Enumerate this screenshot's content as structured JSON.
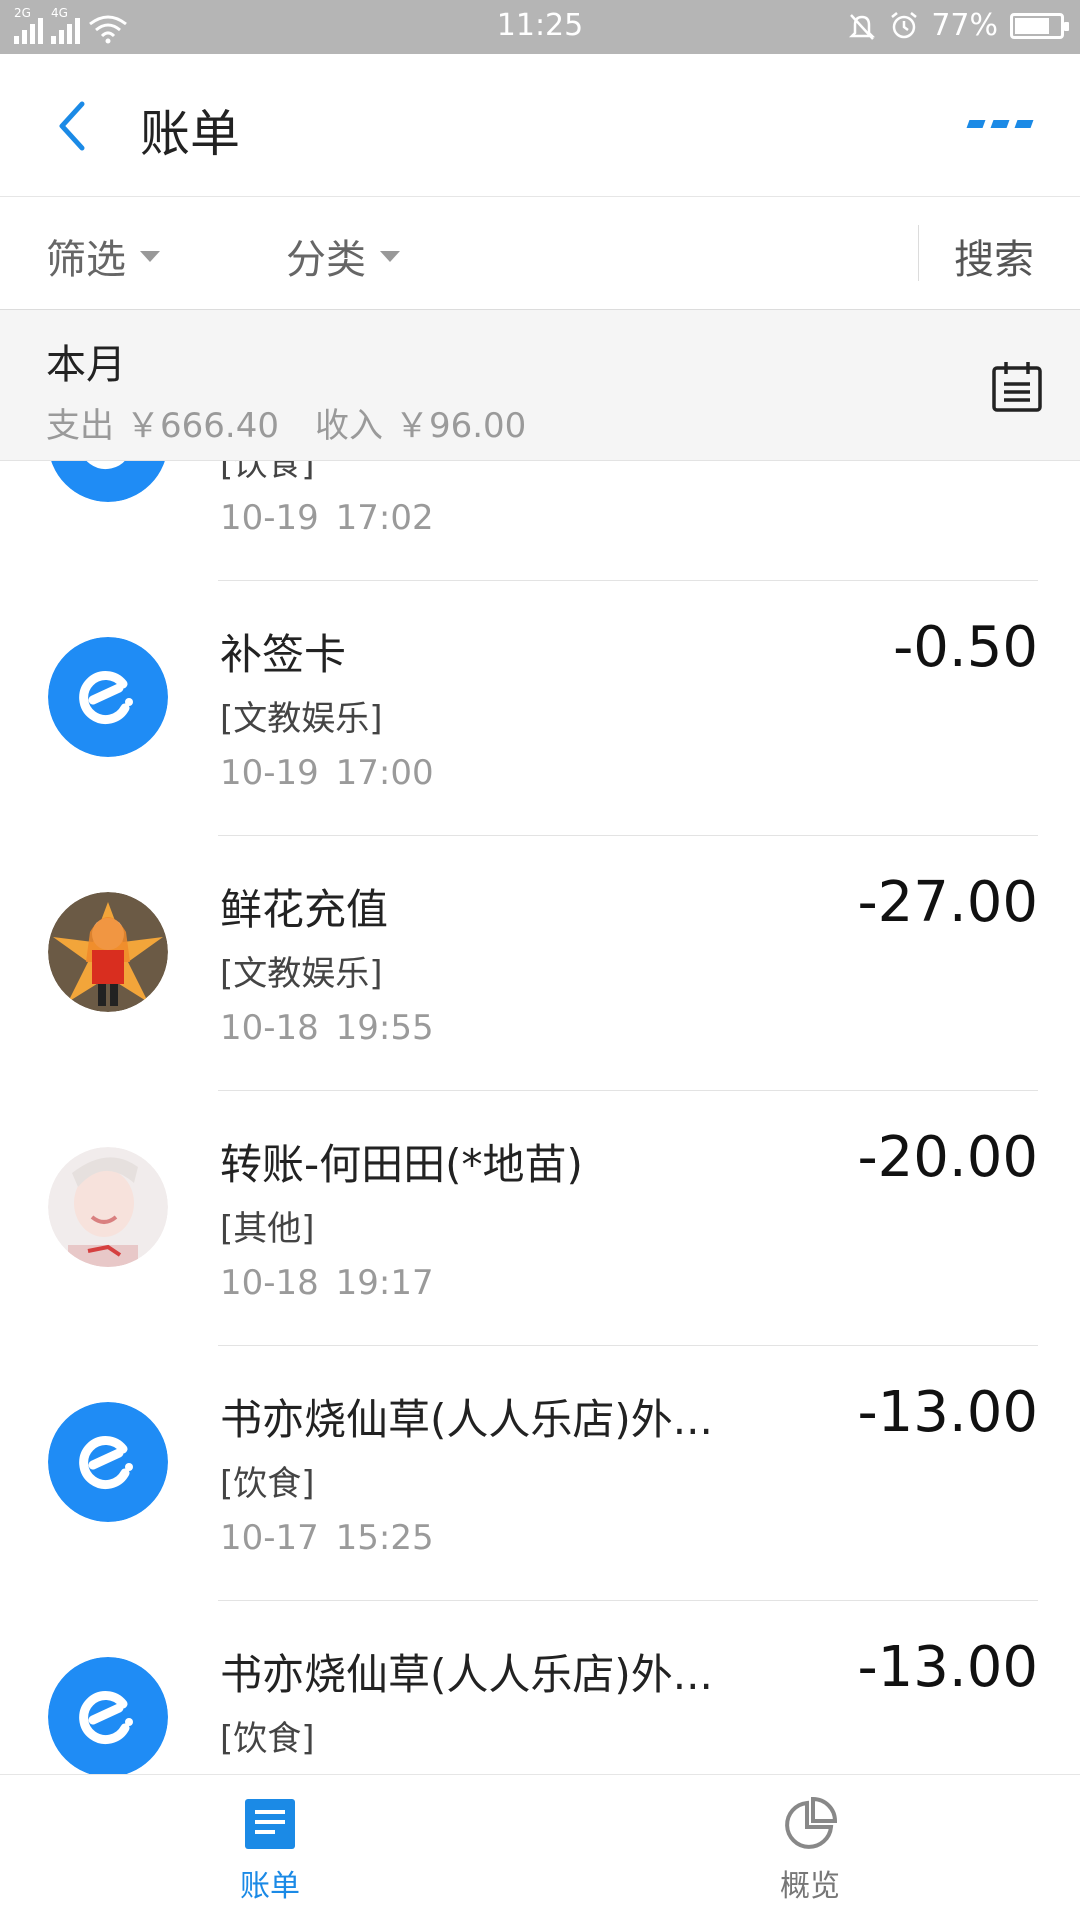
{
  "status_bar": {
    "signal1_label": "2G",
    "signal2_label": "4G",
    "time": "11:25",
    "battery": "77%",
    "battery_level": 0.77
  },
  "header": {
    "title": "账单"
  },
  "filters": {
    "filter_label": "筛选",
    "category_label": "分类",
    "search_label": "搜索"
  },
  "month": {
    "title": "本月",
    "expense_label": "支出",
    "expense_value": "￥666.40",
    "income_label": "收入",
    "income_value": "￥96.00"
  },
  "transactions": [
    {
      "name": "",
      "category": "[饮食]",
      "time": "10-19 17:02",
      "amount": "",
      "avatar": "eleme-icon"
    },
    {
      "name": "补签卡",
      "category": "[文教娱乐]",
      "time": "10-19 17:00",
      "amount": "-0.50",
      "avatar": "eleme-icon"
    },
    {
      "name": "鲜花充值",
      "category": "[文教娱乐]",
      "time": "10-18 19:55",
      "amount": "-27.00",
      "avatar": "anime-avatar"
    },
    {
      "name": "转账-何田田(*地苗)",
      "category": "[其他]",
      "time": "10-18 19:17",
      "amount": "-20.00",
      "avatar": "photo-avatar"
    },
    {
      "name": "书亦烧仙草(人人乐店)外...",
      "category": "[饮食]",
      "time": "10-17 15:25",
      "amount": "-13.00",
      "avatar": "eleme-icon"
    },
    {
      "name": "书亦烧仙草(人人乐店)外...",
      "category": "[饮食]",
      "time": "",
      "amount": "-13.00",
      "avatar": "eleme-icon"
    }
  ],
  "bottom_nav": {
    "bill_label": "账单",
    "overview_label": "概览"
  },
  "colors": {
    "accent": "#1b8ae6",
    "eleme_blue": "#1f8cf5",
    "status_bar": "#b5b5b5"
  }
}
